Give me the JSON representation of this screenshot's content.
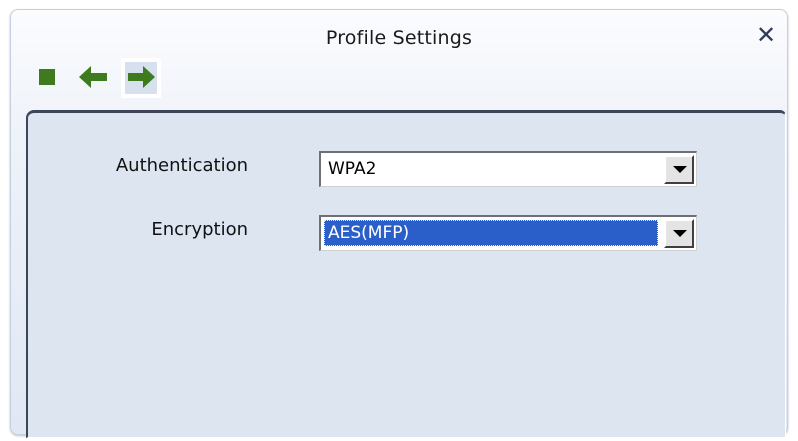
{
  "window": {
    "title": "Profile Settings",
    "close_icon": "close-icon"
  },
  "toolbar": {
    "buttons": [
      {
        "icon": "stop-icon",
        "state": "normal"
      },
      {
        "icon": "back-arrow-icon",
        "state": "normal"
      },
      {
        "icon": "next-arrow-icon",
        "state": "selected"
      }
    ]
  },
  "form": {
    "authentication": {
      "label": "Authentication",
      "value": "WPA2"
    },
    "encryption": {
      "label": "Encryption",
      "value": "AES(MFP)"
    }
  },
  "colors": {
    "icon_green": "#3e7a1e",
    "selection_blue": "#2a5fc9",
    "panel_bg": "#dde5f1"
  }
}
